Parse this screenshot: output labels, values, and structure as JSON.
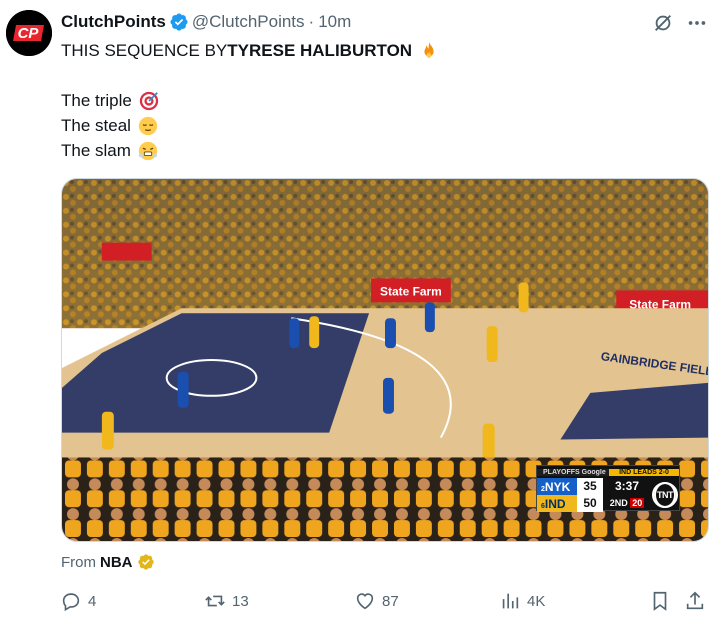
{
  "author": {
    "display_name": "ClutchPoints",
    "handle": "@ClutchPoints",
    "separator": "·",
    "time": "10m",
    "avatar_text": "CP",
    "verified": true
  },
  "tweet": {
    "line1_prefix": "THIS SEQUENCE BY ",
    "line1_bold": "TYRESE HALIBURTON",
    "line1_emoji": "fire-emoji",
    "line3": "The triple",
    "line3_emoji": "target-emoji",
    "line4": "The steal",
    "line4_emoji": "relieved-face-emoji",
    "line5": "The slam",
    "line5_emoji": "steam-face-emoji"
  },
  "media": {
    "kind": "video-frame",
    "arena_banner": "GAINBRIDGE FIELDHOUSE",
    "ad_left": "State Farm",
    "ad_right": "State Farm",
    "scorebug": {
      "brand": "PLAYOFFS",
      "brand_sub": "Google",
      "series": "IND LEADS 2-0",
      "team1": "NYK",
      "team1_seed": "2",
      "score1": "35",
      "team2": "IND",
      "team2_seed": "6",
      "score2": "50",
      "clock": "3:37",
      "period": "2ND",
      "shot_clock": "20",
      "network": "TNT",
      "network_sub": "SPORTS"
    }
  },
  "source": {
    "label": "From",
    "name": "NBA"
  },
  "actions": {
    "replies": "4",
    "retweets": "13",
    "likes": "87",
    "views": "4K"
  },
  "colors": {
    "text": "#0f1419",
    "secondary": "#536471",
    "verified_blue": "#1d9bf0",
    "verified_gold": "#e2b719"
  }
}
